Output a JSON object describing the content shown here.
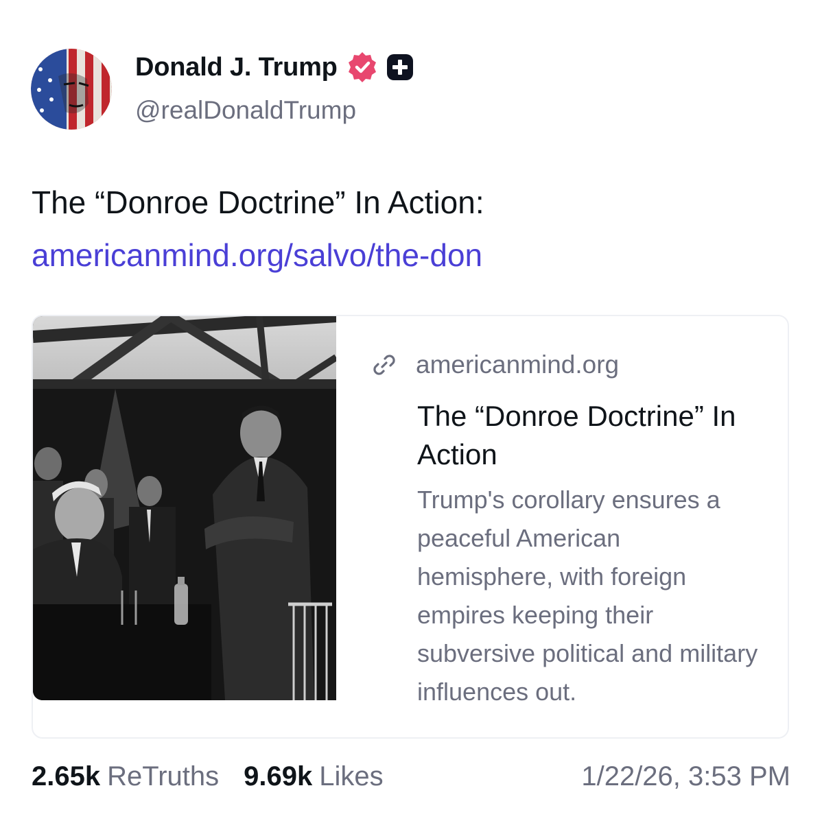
{
  "author": {
    "display_name": "Donald J. Trump",
    "handle": "@realDonaldTrump"
  },
  "post": {
    "text": "The “Donroe Doctrine” In Action:",
    "link_text": "americanmind.org/salvo/the-don"
  },
  "link_card": {
    "domain": "americanmind.org",
    "title": "The “Donroe Doctrine” In Action",
    "description": "Trump's corollary ensures a peaceful American hemisphere, with foreign empires keeping their subversive political and military influences out."
  },
  "stats": {
    "retruths_count": "2.65k",
    "retruths_label": "ReTruths",
    "likes_count": "9.69k",
    "likes_label": "Likes",
    "timestamp": "1/22/26, 3:53 PM"
  },
  "icons": {
    "verified": "verified-badge-icon",
    "plus": "plus-badge-icon",
    "link": "link-icon"
  },
  "colors": {
    "link": "#4a3fd6",
    "verified": "#e8476f",
    "muted_text": "#6b6e7e"
  }
}
